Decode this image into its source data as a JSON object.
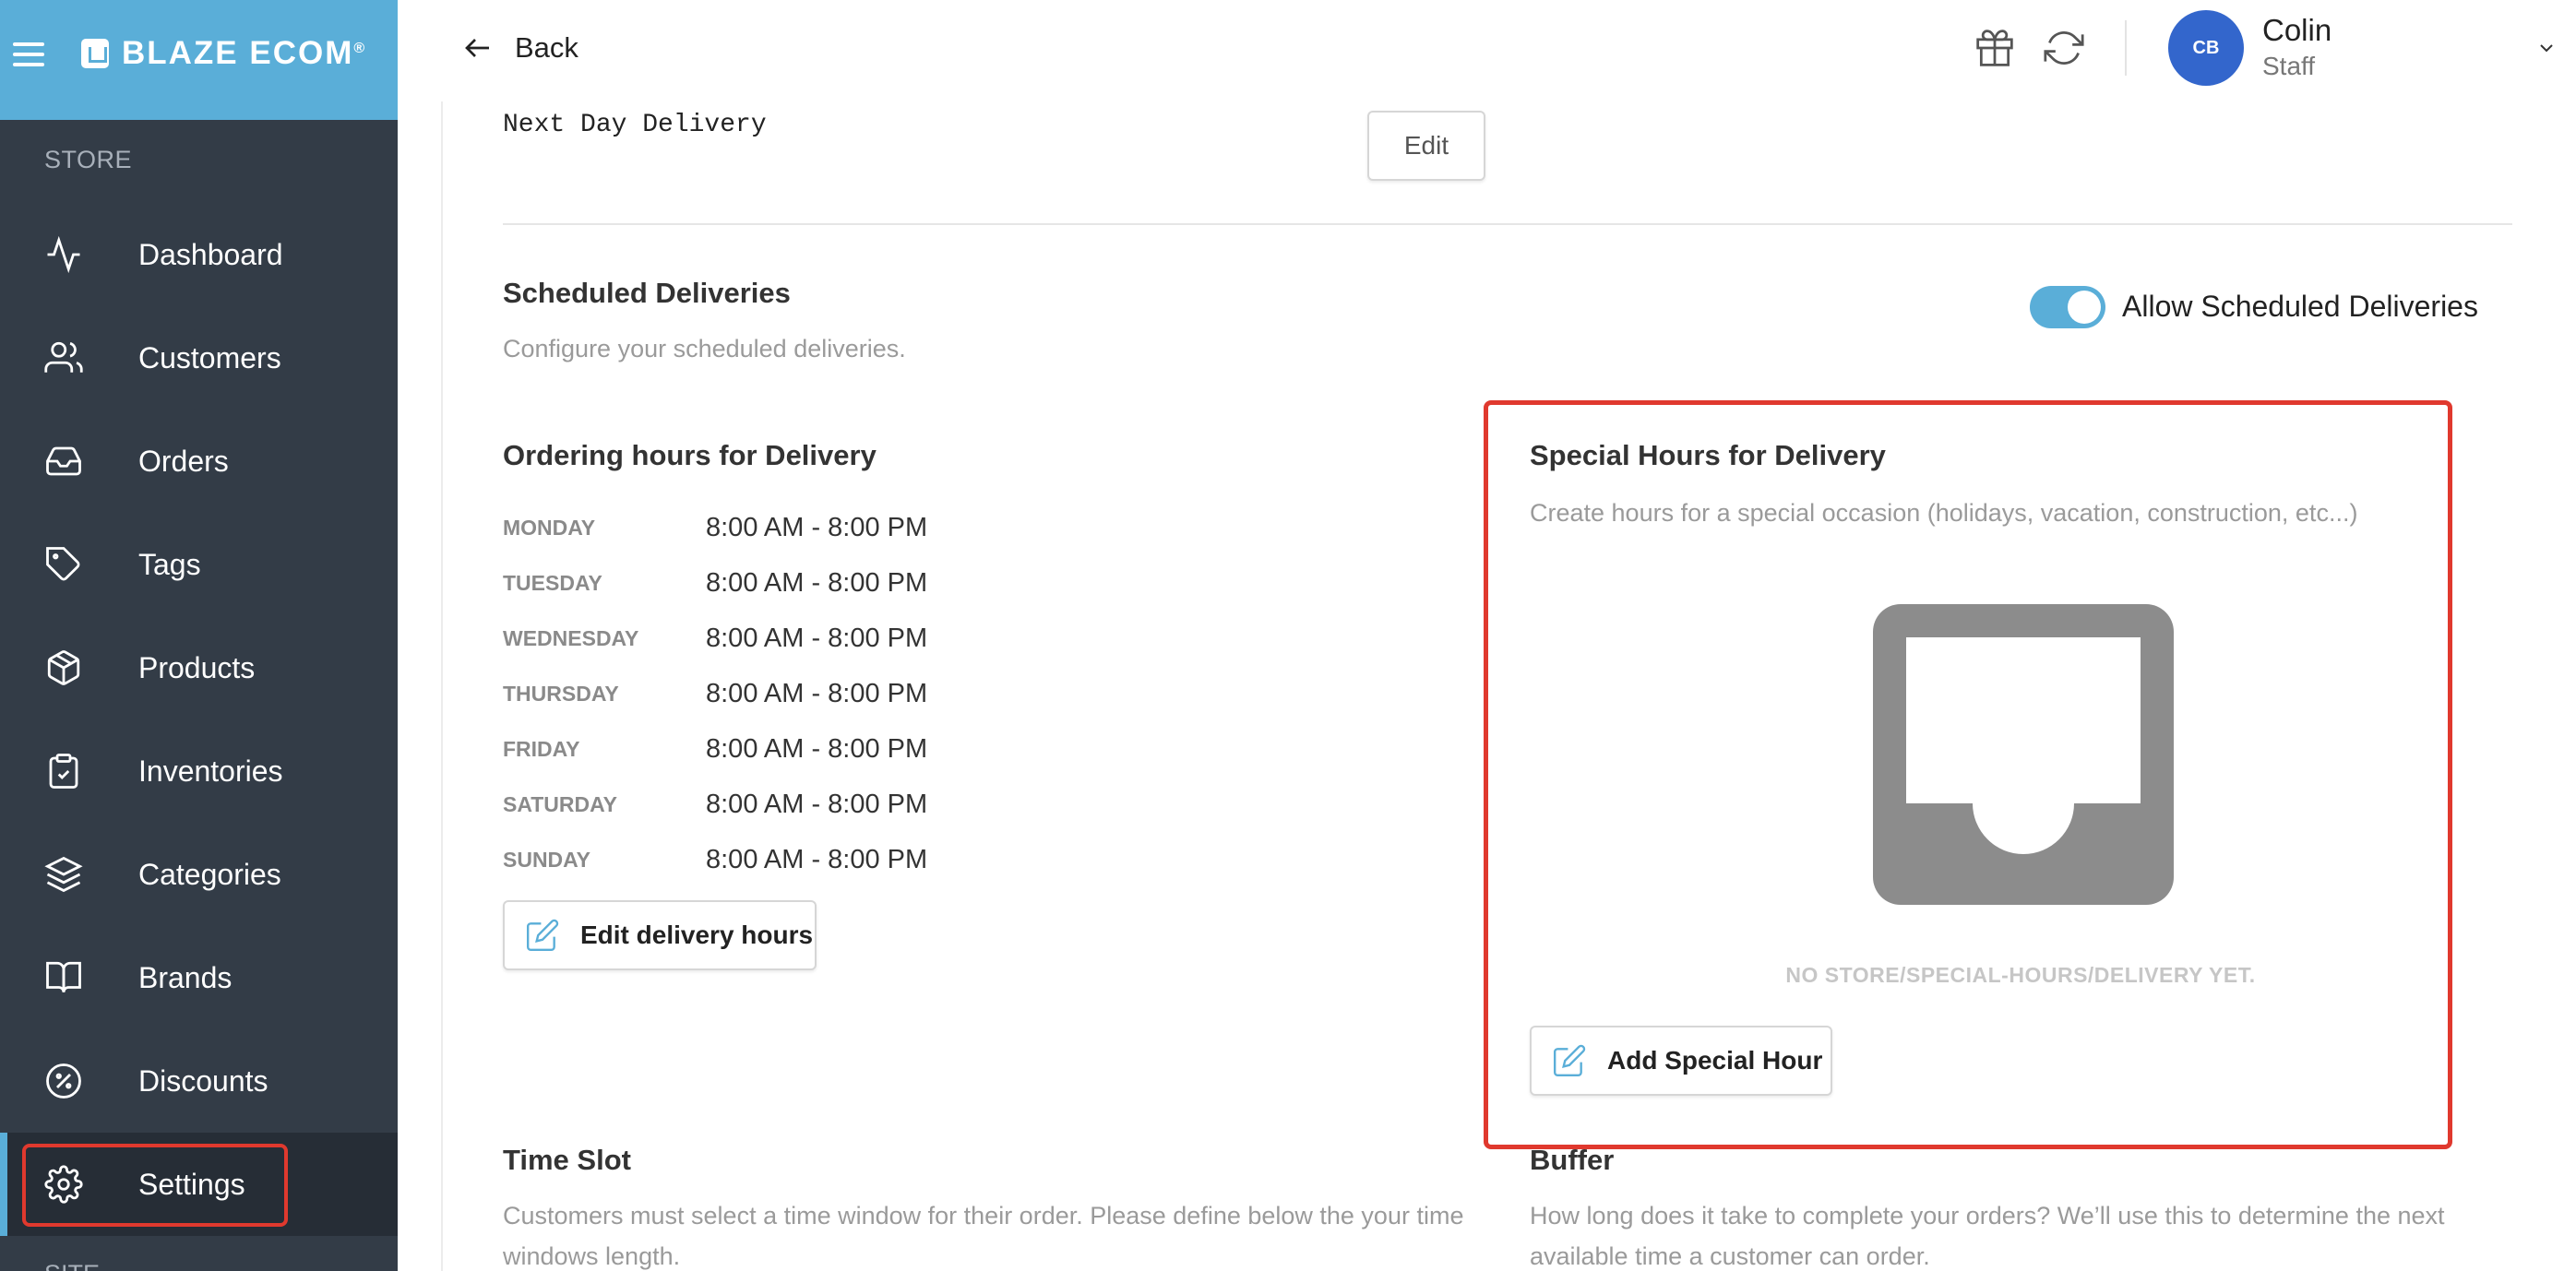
{
  "brand": {
    "name": "BLAZE ECOM",
    "mark": "®"
  },
  "sidebar": {
    "section_store": "STORE",
    "section_site": "SITE",
    "items": [
      {
        "label": "Dashboard",
        "icon": "activity-icon"
      },
      {
        "label": "Customers",
        "icon": "users-icon"
      },
      {
        "label": "Orders",
        "icon": "inbox-icon"
      },
      {
        "label": "Tags",
        "icon": "tag-icon"
      },
      {
        "label": "Products",
        "icon": "package-icon"
      },
      {
        "label": "Inventories",
        "icon": "clipboard-icon"
      },
      {
        "label": "Categories",
        "icon": "layers-icon"
      },
      {
        "label": "Brands",
        "icon": "book-icon"
      },
      {
        "label": "Discounts",
        "icon": "percent-icon"
      },
      {
        "label": "Settings",
        "icon": "gear-icon",
        "active": true
      }
    ]
  },
  "header": {
    "back_label": "Back",
    "user": {
      "initials": "CB",
      "name": "Colin",
      "role": "Staff"
    }
  },
  "delivery": {
    "type_text": "Next Day Delivery",
    "edit_label": "Edit"
  },
  "scheduled": {
    "title": "Scheduled Deliveries",
    "subtitle": "Configure your scheduled deliveries.",
    "toggle_label": "Allow Scheduled Deliveries",
    "toggle_on": true
  },
  "ordering_hours": {
    "title": "Ordering hours for Delivery",
    "rows": [
      {
        "day": "MONDAY",
        "time": "8:00 AM - 8:00 PM"
      },
      {
        "day": "TUESDAY",
        "time": "8:00 AM - 8:00 PM"
      },
      {
        "day": "WEDNESDAY",
        "time": "8:00 AM - 8:00 PM"
      },
      {
        "day": "THURSDAY",
        "time": "8:00 AM - 8:00 PM"
      },
      {
        "day": "FRIDAY",
        "time": "8:00 AM - 8:00 PM"
      },
      {
        "day": "SATURDAY",
        "time": "8:00 AM - 8:00 PM"
      },
      {
        "day": "SUNDAY",
        "time": "8:00 AM - 8:00 PM"
      }
    ],
    "edit_button": "Edit delivery hours"
  },
  "special_hours": {
    "title": "Special Hours for Delivery",
    "subtitle": "Create hours for a special occasion (holidays, vacation, construction, etc...)",
    "empty_text": "NO STORE/SPECIAL-HOURS/DELIVERY YET.",
    "add_button": "Add Special Hour"
  },
  "time_slot": {
    "title": "Time Slot",
    "description": "Customers must select a time window for their order. Please define below the your time windows length."
  },
  "buffer": {
    "title": "Buffer",
    "description": "How long does it take to complete your orders? We’ll use this to determine the next available time a customer can order."
  },
  "colors": {
    "sidebar_bg": "#333c47",
    "brand_bar": "#5aaed8",
    "accent": "#5aaed8",
    "highlight": "#e0392e",
    "avatar": "#3366cc"
  }
}
